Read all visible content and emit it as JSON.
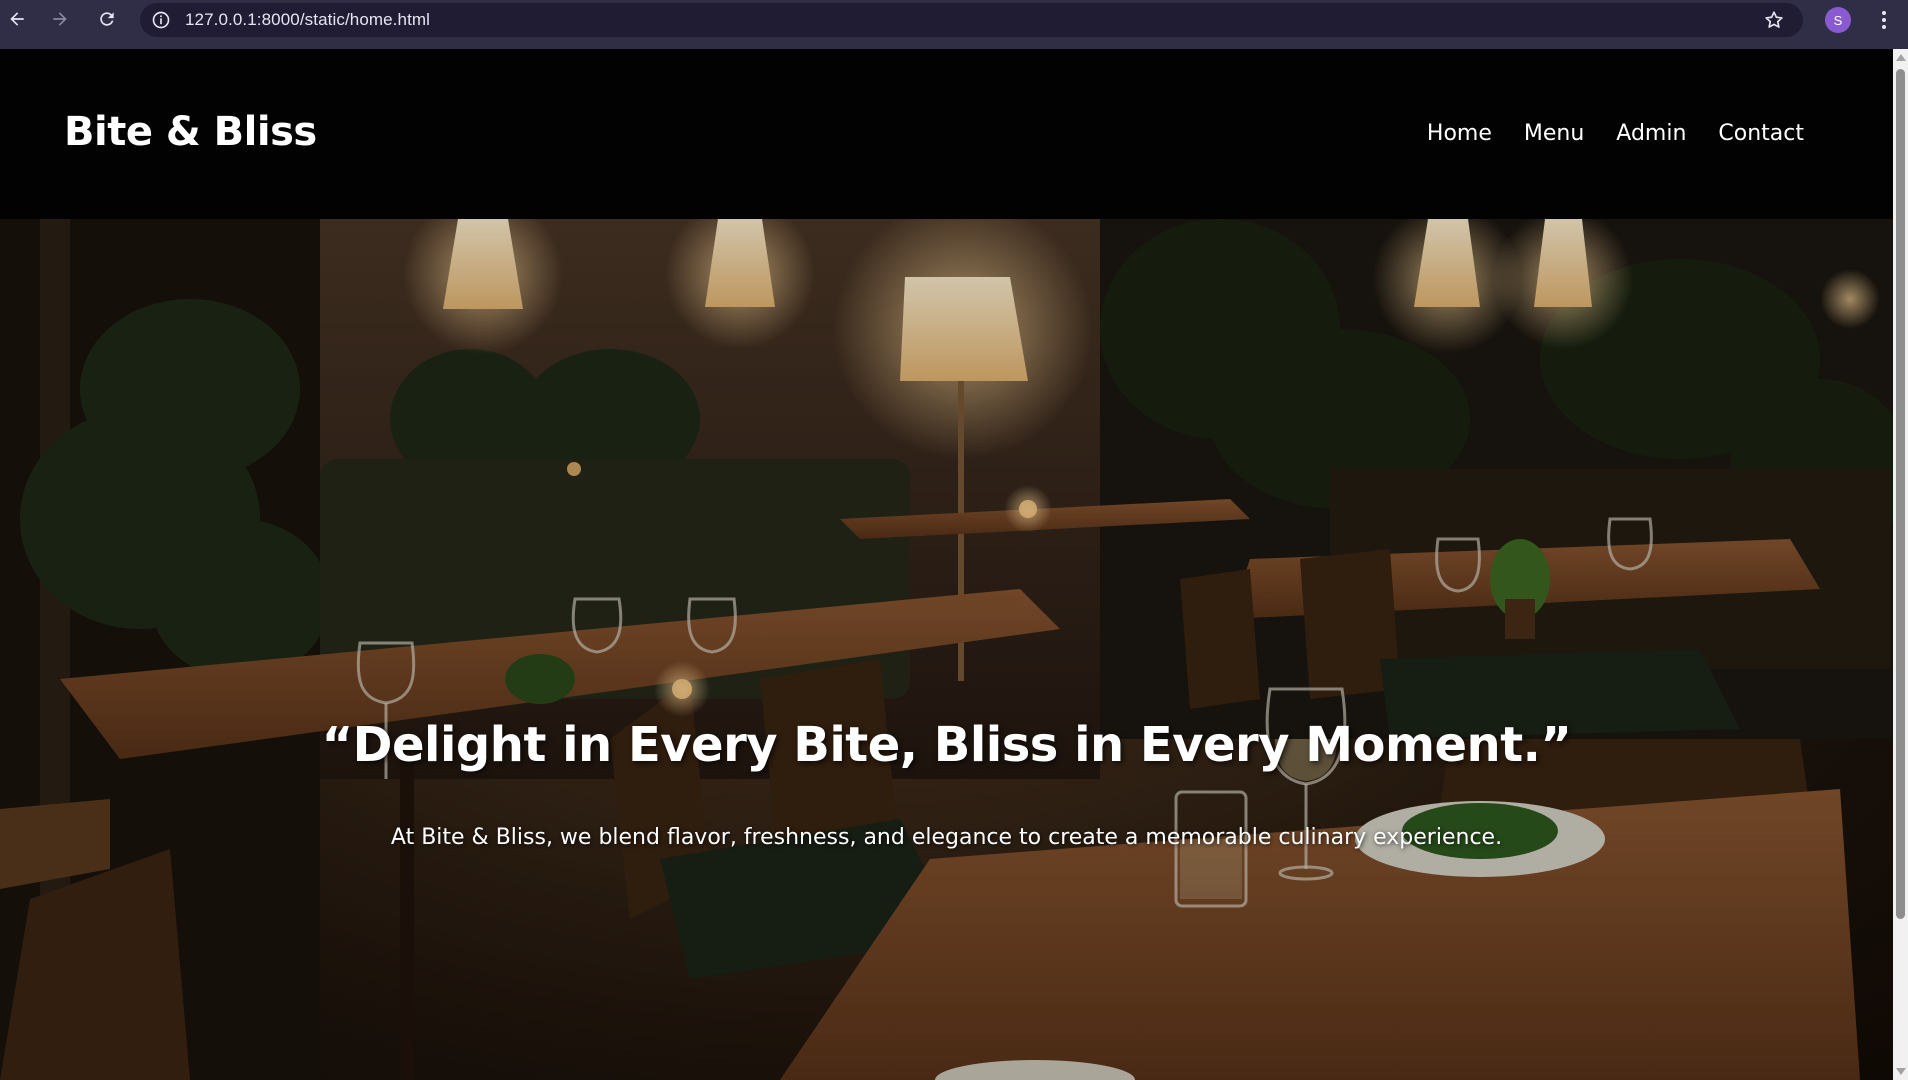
{
  "browser": {
    "url": "127.0.0.1:8000/static/home.html",
    "profile_initial": "S",
    "icons": {
      "back": "arrow-left-icon",
      "forward": "arrow-right-icon",
      "reload": "reload-icon",
      "site_info": "info-icon",
      "bookmark": "star-icon",
      "menu": "kebab-menu-icon"
    },
    "colors": {
      "toolbar": "#302d47",
      "url_bg": "#1f1c33",
      "avatar": "#8a5ad1"
    }
  },
  "header": {
    "brand": "Bite & Bliss",
    "nav": [
      {
        "label": "Home"
      },
      {
        "label": "Menu"
      },
      {
        "label": "Admin"
      },
      {
        "label": "Contact"
      }
    ]
  },
  "hero": {
    "title": "“Delight in Every Bite, Bliss in Every Moment.”",
    "subtitle": "At Bite & Bliss, we blend flavor, freshness, and elegance to create a memorable culinary experience.",
    "background": "restaurant-interior-photo"
  }
}
